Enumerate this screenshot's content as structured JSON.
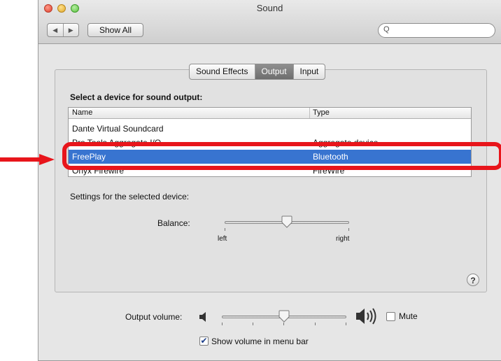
{
  "window": {
    "title": "Sound"
  },
  "toolbar": {
    "show_all": "Show All",
    "back_glyph": "◀",
    "forward_glyph": "▶"
  },
  "search": {
    "icon": "search-icon",
    "glyph": "Q"
  },
  "tabs": [
    {
      "label": "Sound Effects",
      "active": false
    },
    {
      "label": "Output",
      "active": true
    },
    {
      "label": "Input",
      "active": false
    }
  ],
  "output": {
    "select_label": "Select a device for sound output:",
    "columns": [
      "Name",
      "Type"
    ],
    "rows": [
      {
        "name": "Dante Virtual Soundcard",
        "type": ""
      },
      {
        "name": "Pro Tools Aggregate I/O",
        "type": "Aggregate device"
      },
      {
        "name": "FreePlay",
        "type": "Bluetooth"
      },
      {
        "name": "Onyx Firewire",
        "type": "FireWire"
      }
    ],
    "selected_row": 2,
    "settings_label": "Settings for the selected device:",
    "balance": {
      "label": "Balance:",
      "left": "left",
      "right": "right",
      "value": 0.5
    }
  },
  "help": {
    "glyph": "?"
  },
  "volume": {
    "label": "Output volume:",
    "value": 0.5,
    "mute_label": "Mute",
    "mute_checked": false,
    "menu_bar_label": "Show volume in menu bar",
    "menu_bar_checked": true,
    "check_glyph": "✔"
  },
  "annotation": {
    "color": "#e8151b"
  },
  "colors": {
    "selection": "#3874d0",
    "accent_red": "#e8151b"
  }
}
